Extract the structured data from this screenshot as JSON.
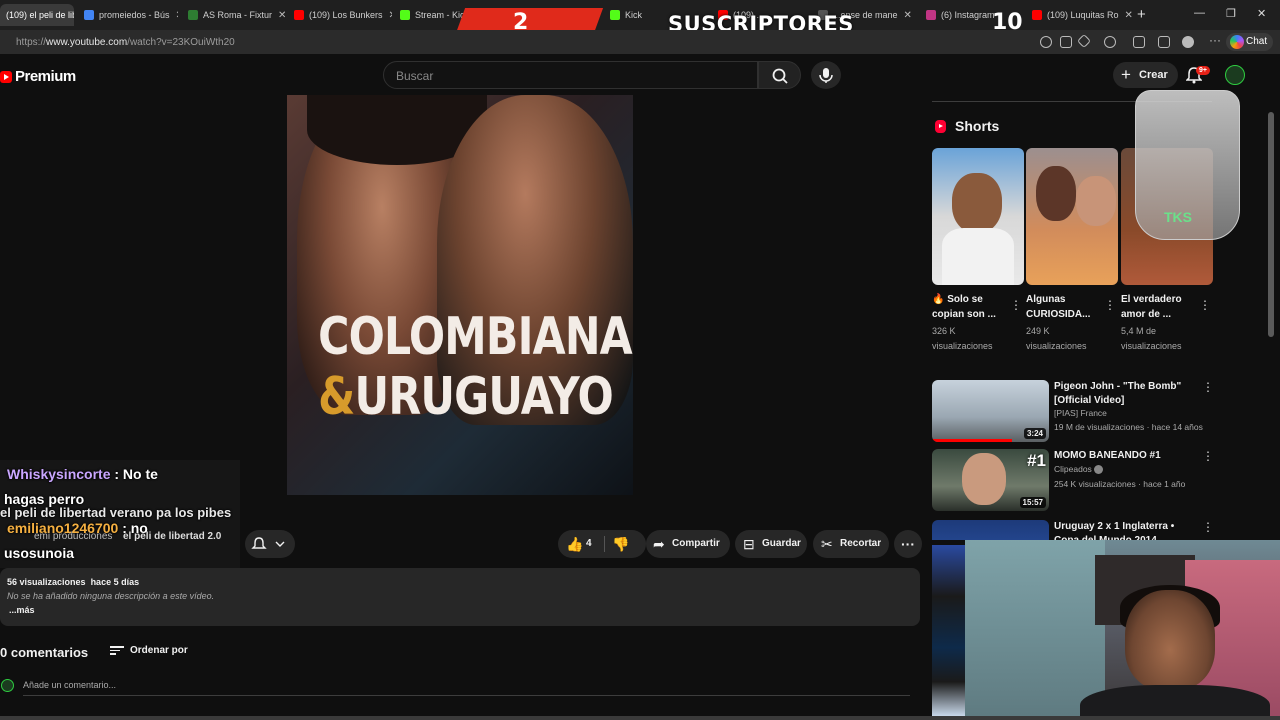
{
  "browser": {
    "tabs": [
      {
        "label": "(109) el peli de lib",
        "favicon_color": "#ff0000",
        "active": true
      },
      {
        "label": "promeiedos - Bús",
        "favicon_color": "#4285f4",
        "active": false
      },
      {
        "label": "AS Roma - Fixtur",
        "favicon_color": "#2e7d32",
        "active": false
      },
      {
        "label": "(109) Los Bunkers",
        "favicon_color": "#ff0000",
        "active": false
      },
      {
        "label": "Stream - Kick Das",
        "favicon_color": "#53fc18",
        "active": false
      },
      {
        "label": "Kick",
        "favicon_color": "#53fc18",
        "active": false
      },
      {
        "label": "(109) ...",
        "favicon_color": "#ff0000",
        "active": false
      },
      {
        "label": "...ense de mane",
        "favicon_color": "#555555",
        "active": false
      },
      {
        "label": "(6) Instagram",
        "favicon_color": "#c13584",
        "active": false
      },
      {
        "label": "(109) Luquitas Ro",
        "favicon_color": "#ff0000",
        "active": false
      }
    ],
    "new_tab": "+",
    "window_controls": [
      "—",
      "❐",
      "✕"
    ],
    "url_prefix": "https://",
    "url_host": "www.youtube.com",
    "url_path": "/watch?v=23KOuiWth20",
    "chat_button": "Chat"
  },
  "stream_overlay": {
    "left_number": "2",
    "label": "SUSCRIPTORES",
    "right_number": "10",
    "accent_color": "#e02a1b"
  },
  "youtube": {
    "logo_text": "Premium",
    "search_placeholder": "Buscar",
    "create_label": "Crear",
    "notifications_badge": "9+"
  },
  "video": {
    "thumbnail_line1": "COLOMBIANA",
    "thumbnail_amp": "&",
    "thumbnail_line2": "URUGUAYO",
    "channel_name": "emi producciones",
    "title_fragment": "el peli de libertad 2.0",
    "like_count": "4",
    "share_label": "Compartir",
    "save_label": "Guardar",
    "clip_label": "Recortar",
    "views": "56 visualizaciones",
    "uploaded": "hace 5 días",
    "description": "No se ha añadido ninguna descripción a este vídeo.",
    "more": "...más"
  },
  "chat_overlay": [
    {
      "user": "Whiskysincorte",
      "user_color": "#c9a6ff",
      "text": ": No te"
    },
    {
      "user": "",
      "user_color": "#ffffff",
      "text": "hagas perro"
    },
    {
      "user": "",
      "user_color": "#ffffff",
      "text": "el peli de libertad verano pa los pibes"
    },
    {
      "user": "emiliano1246700",
      "user_color": "#f5b041",
      "text": ": no"
    },
    {
      "user": "",
      "user_color": "#ffffff",
      "text": "usosunoia"
    }
  ],
  "comments": {
    "heading": "0 comentarios",
    "sort_label": "Ordenar por",
    "add_placeholder": "Añade un comentario..."
  },
  "shorts": {
    "heading": "Shorts",
    "items": [
      {
        "title": "🔥 Solo se copian son ...",
        "views_line1": "326 K",
        "views_line2": "visualizaciones"
      },
      {
        "title": "Algunas CURIOSIDA...",
        "views_line1": "249 K",
        "views_line2": "visualizaciones"
      },
      {
        "title": "El verdadero amor de ...",
        "views_line1": "5,4 M de",
        "views_line2": "visualizaciones"
      }
    ]
  },
  "cup_text": "TKS",
  "recommendations": [
    {
      "title": "Pigeon John - \"The Bomb\" [Official Video]",
      "channel": "[PIAS] France",
      "meta": "19 M de visualizaciones · hace 14 años",
      "duration": "3:24"
    },
    {
      "title": "MOMO BANEANDO #1",
      "channel": "Clipeados",
      "meta": "254 K visualizaciones · hace 1 año",
      "duration": "15:57",
      "badge": "#1"
    },
    {
      "title": "Uruguay 2 x 1 Inglaterra • Copa del Mundo 2014 Resumen",
      "channel": "",
      "meta": "",
      "duration": ""
    }
  ]
}
